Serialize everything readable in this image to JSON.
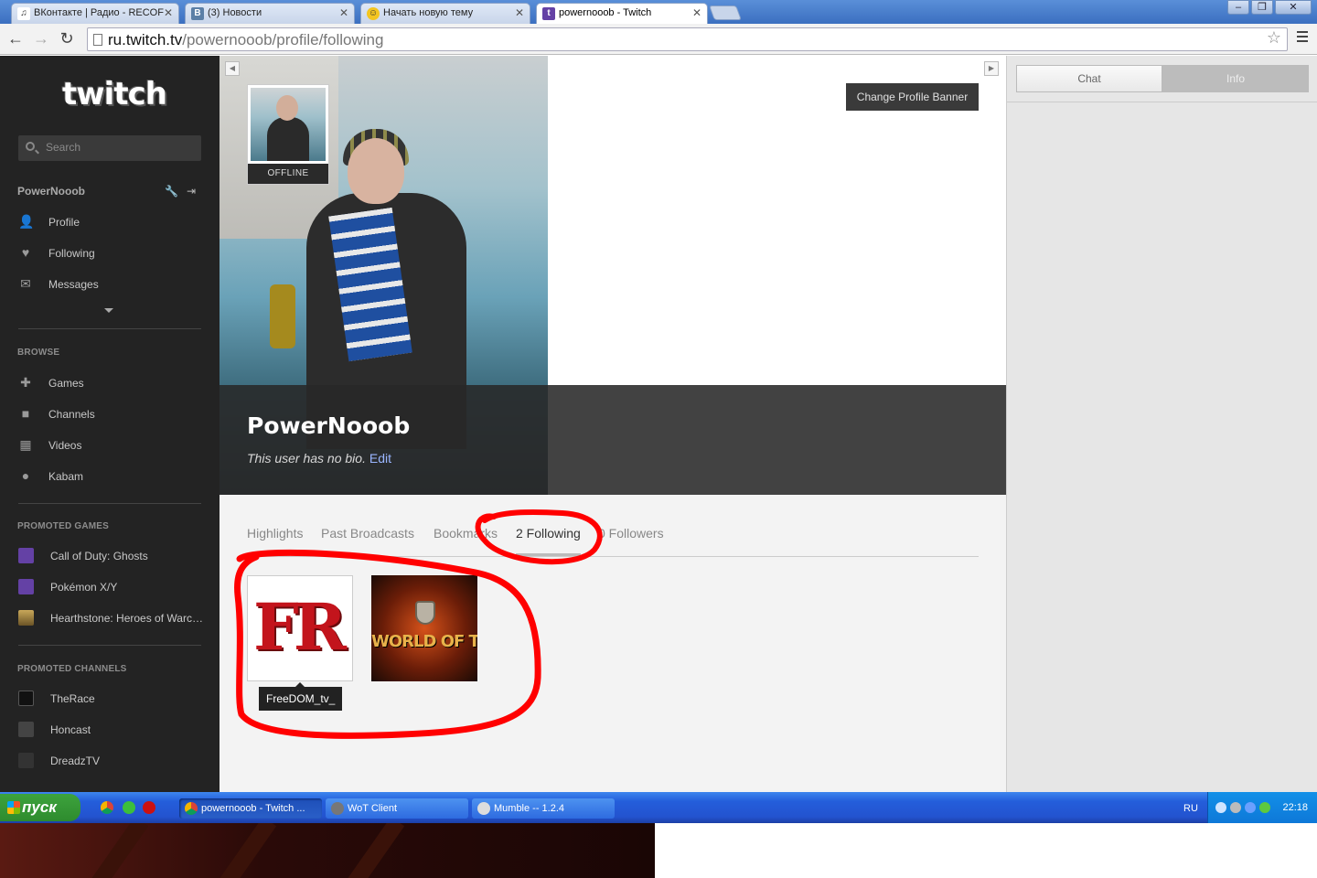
{
  "browser": {
    "tabs": [
      {
        "title": "ВКонтакте | Радио - RECOF",
        "favicon": "music-note-icon"
      },
      {
        "title": "(3) Новости",
        "favicon": "vk-icon"
      },
      {
        "title": "Начать новую тему",
        "favicon": "smiley-icon"
      },
      {
        "title": "powernooob - Twitch",
        "favicon": "twitch-icon",
        "active": true
      }
    ],
    "url_domain": "ru.twitch.tv",
    "url_path": "/powernooob/profile/following"
  },
  "sidebar": {
    "logo": "twitch",
    "search_placeholder": "Search",
    "username": "PowerNooob",
    "user_items": [
      {
        "label": "Profile",
        "icon": "person-icon"
      },
      {
        "label": "Following",
        "icon": "heart-icon"
      },
      {
        "label": "Messages",
        "icon": "envelope-icon"
      }
    ],
    "browse_header": "BROWSE",
    "browse_items": [
      {
        "label": "Games",
        "icon": "gamepad-icon"
      },
      {
        "label": "Channels",
        "icon": "camera-icon"
      },
      {
        "label": "Videos",
        "icon": "film-grid-icon"
      },
      {
        "label": "Kabam",
        "icon": "kabam-icon"
      }
    ],
    "promoted_games_header": "PROMOTED GAMES",
    "promoted_games": [
      {
        "label": "Call of Duty: Ghosts"
      },
      {
        "label": "Pokémon X/Y"
      },
      {
        "label": "Hearthstone: Heroes of Warcraft"
      }
    ],
    "promoted_channels_header": "PROMOTED CHANNELS",
    "promoted_channels": [
      {
        "label": "TheRace"
      },
      {
        "label": "Honcast"
      },
      {
        "label": "DreadzTV"
      }
    ]
  },
  "banner": {
    "status": "OFFLINE",
    "change_banner_label": "Change Profile Banner",
    "profile_name": "PowerNooob",
    "bio_text": "This user has no bio.",
    "bio_edit": "Edit"
  },
  "profile_tabs": {
    "highlights": "Highlights",
    "past_broadcasts": "Past Broadcasts",
    "bookmarks": "Bookmarks",
    "following": "2 Following",
    "followers": "0 Followers"
  },
  "following": {
    "freedom_logo": "FR",
    "wot_logo": "WORLD OF TANKS",
    "tooltip": "FreeDOM_tv_"
  },
  "right_panel": {
    "chat_tab": "Chat",
    "info_tab": "Info"
  },
  "taskbar": {
    "start_label": "пуск",
    "tasks": [
      {
        "label": "powernooob - Twitch ...",
        "active": true
      },
      {
        "label": "WoT Client"
      },
      {
        "label": "Mumble -- 1.2.4"
      }
    ],
    "lang": "RU",
    "clock": "22:18"
  },
  "colors": {
    "sidebar_bg": "#232323",
    "annotation_red": "#ff0000",
    "taskbar_blue": "#245edb"
  }
}
